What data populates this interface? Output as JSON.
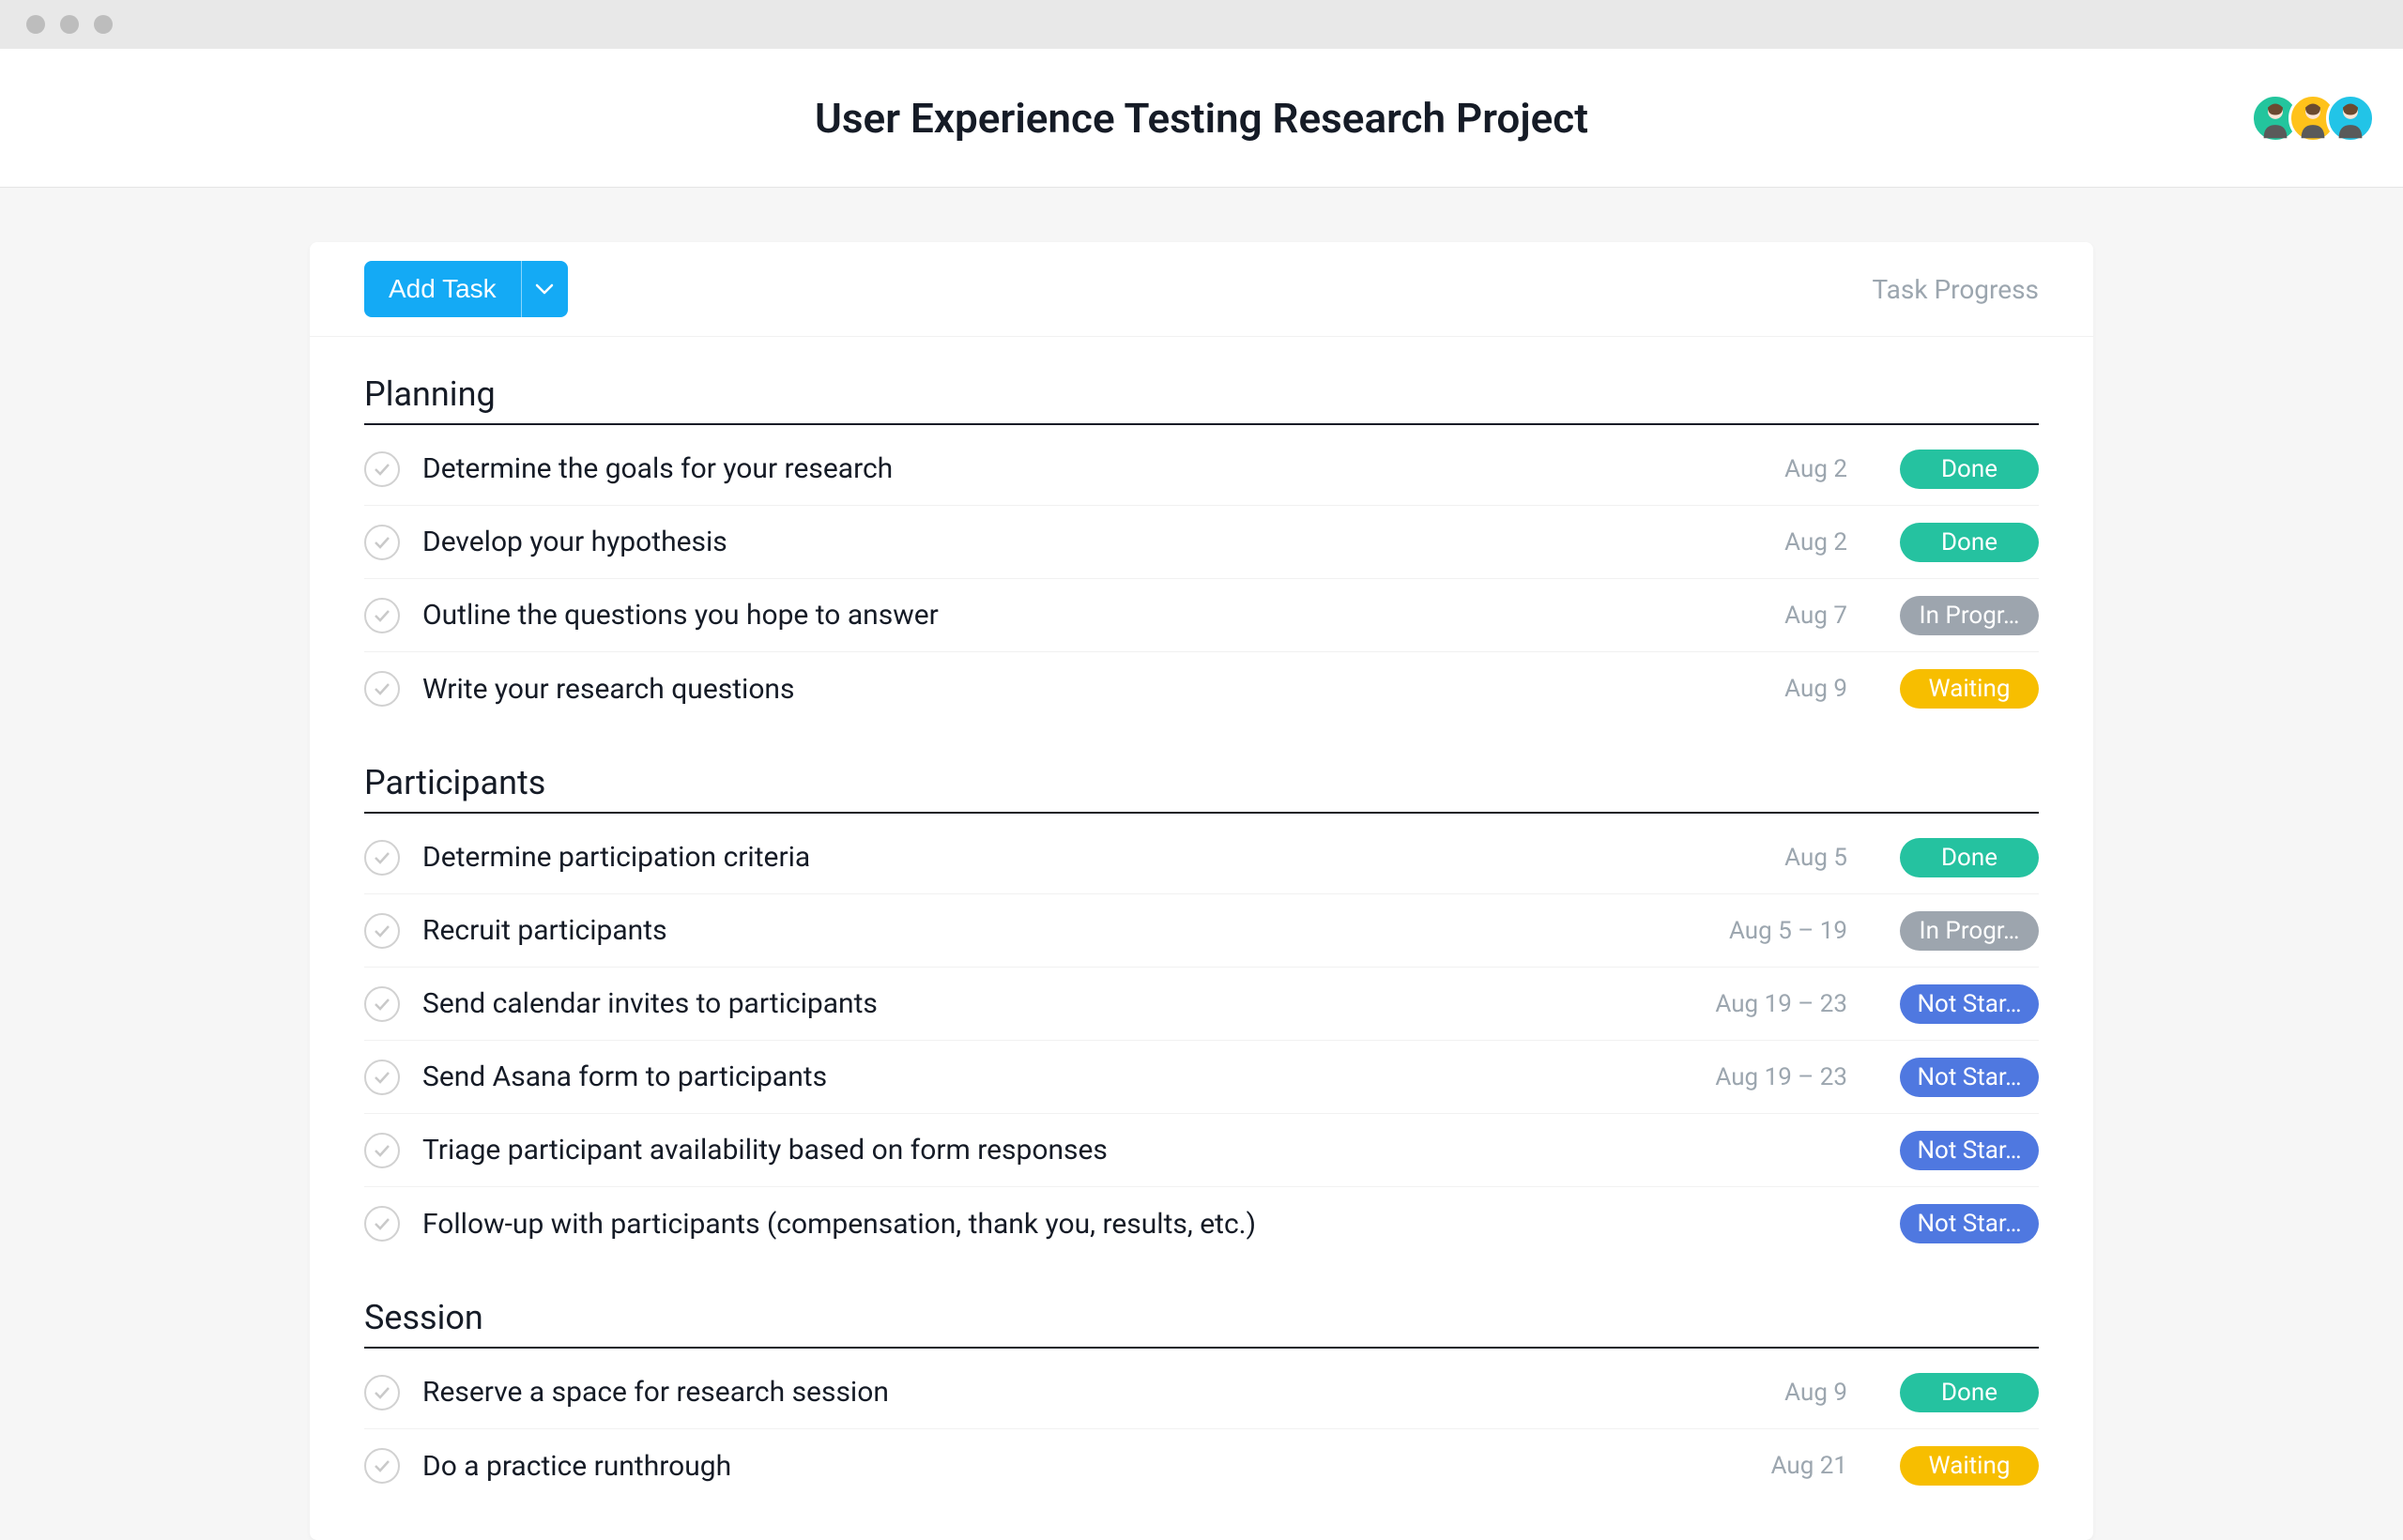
{
  "header": {
    "title": "User Experience Testing Research Project"
  },
  "avatars": [
    {
      "bg": "#23c59d"
    },
    {
      "bg": "#ffc21a"
    },
    {
      "bg": "#22c4e7"
    }
  ],
  "toolbar": {
    "add_label": "Add Task",
    "progress_label": "Task Progress"
  },
  "status_styles": {
    "Done": "pill-done",
    "In Progr…": "pill-in-progress",
    "Waiting": "pill-waiting",
    "Not Star…": "pill-not-started"
  },
  "sections": [
    {
      "title": "Planning",
      "tasks": [
        {
          "title": "Determine the goals for your research",
          "date": "Aug 2",
          "status": "Done"
        },
        {
          "title": "Develop your hypothesis",
          "date": "Aug 2",
          "status": "Done"
        },
        {
          "title": "Outline the questions you hope to answer",
          "date": "Aug 7",
          "status": "In Progr…"
        },
        {
          "title": "Write your research questions",
          "date": "Aug 9",
          "status": "Waiting"
        }
      ]
    },
    {
      "title": "Participants",
      "tasks": [
        {
          "title": "Determine participation criteria",
          "date": "Aug 5",
          "status": "Done"
        },
        {
          "title": "Recruit participants",
          "date": "Aug 5 – 19",
          "status": "In Progr…"
        },
        {
          "title": "Send calendar invites to participants",
          "date": "Aug 19 – 23",
          "status": "Not Star…"
        },
        {
          "title": "Send Asana form to participants",
          "date": "Aug 19 – 23",
          "status": "Not Star…"
        },
        {
          "title": "Triage participant availability based on form responses",
          "date": "",
          "status": "Not Star…"
        },
        {
          "title": "Follow-up with participants (compensation, thank you, results, etc.)",
          "date": "",
          "status": "Not Star…"
        }
      ]
    },
    {
      "title": "Session",
      "tasks": [
        {
          "title": "Reserve a space for research session",
          "date": "Aug 9",
          "status": "Done"
        },
        {
          "title": "Do a practice runthrough",
          "date": "Aug 21",
          "status": "Waiting"
        }
      ]
    }
  ]
}
